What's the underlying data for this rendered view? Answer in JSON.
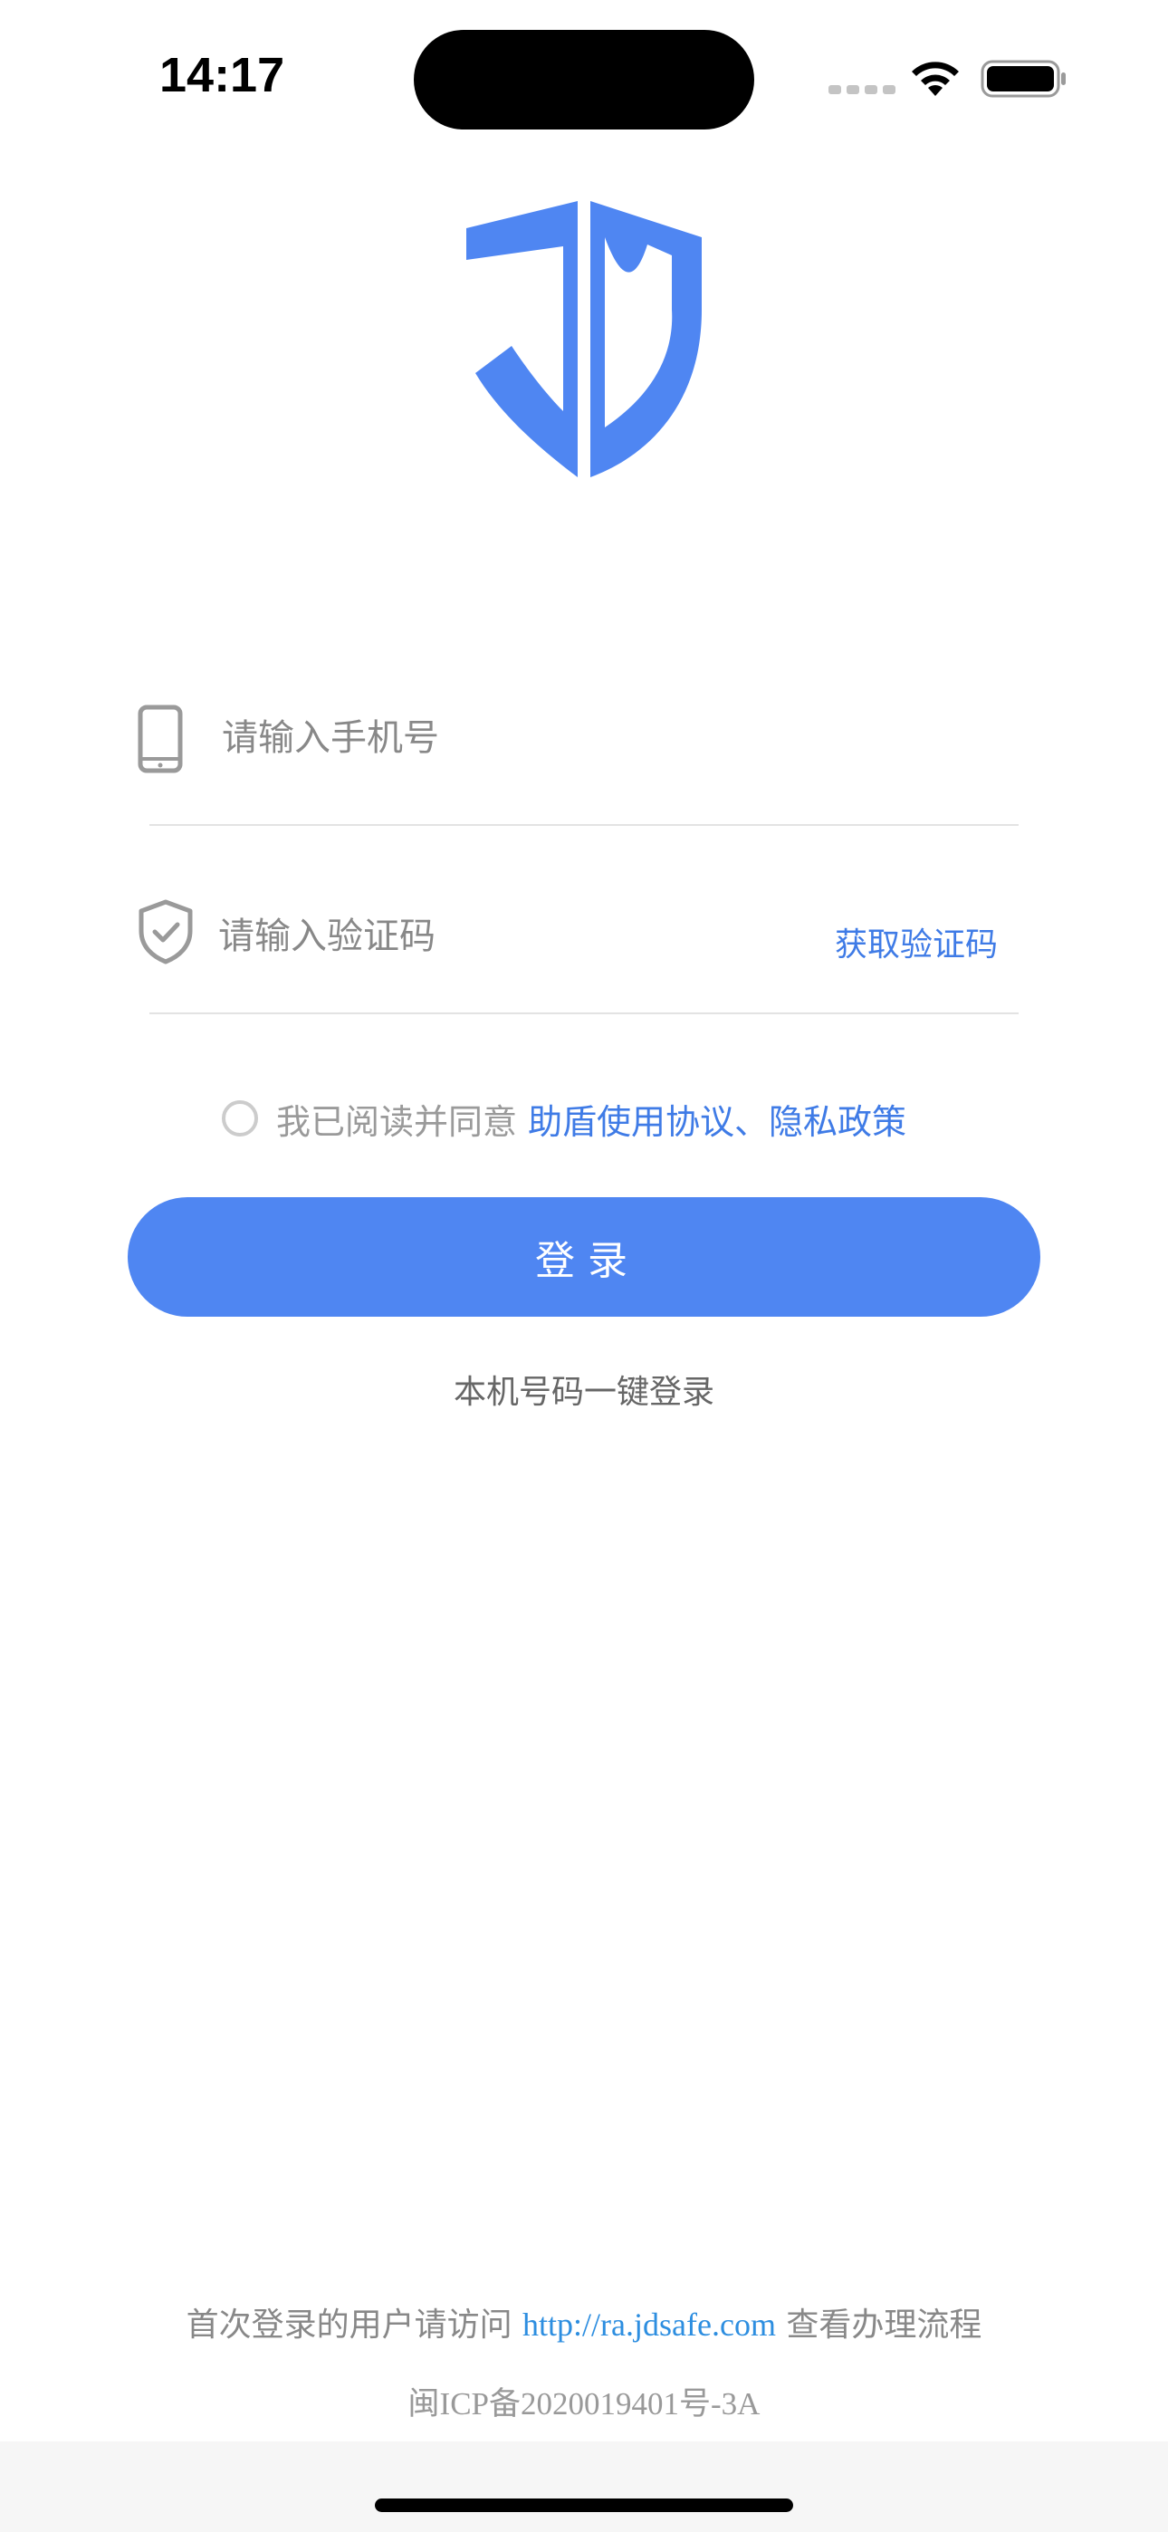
{
  "status_bar": {
    "time": "14:17"
  },
  "logo": {
    "icon": "jd-shield-logo",
    "color": "#4f86f2"
  },
  "form": {
    "phone": {
      "icon": "phone-icon",
      "placeholder": "请输入手机号",
      "value": ""
    },
    "code": {
      "icon": "shield-check-icon",
      "placeholder": "请输入验证码",
      "value": "",
      "get_code_label": "获取验证码"
    }
  },
  "agreement": {
    "checked": false,
    "prefix": "我已阅读并同意",
    "terms_link": "助盾使用协议",
    "separator": "、",
    "privacy_link": "隐私政策"
  },
  "login_button": {
    "label": "登录"
  },
  "one_key_login": {
    "label": "本机号码一键登录"
  },
  "footer": {
    "visit_prefix": "首次登录的用户请访问",
    "url": "http://ra.jdsafe.com",
    "visit_suffix": "查看办理流程",
    "icp": "闽ICP备2020019401号-3A"
  },
  "colors": {
    "accent": "#4f86f2",
    "link": "#3f7be6",
    "footer_link": "#2d8ee0"
  }
}
